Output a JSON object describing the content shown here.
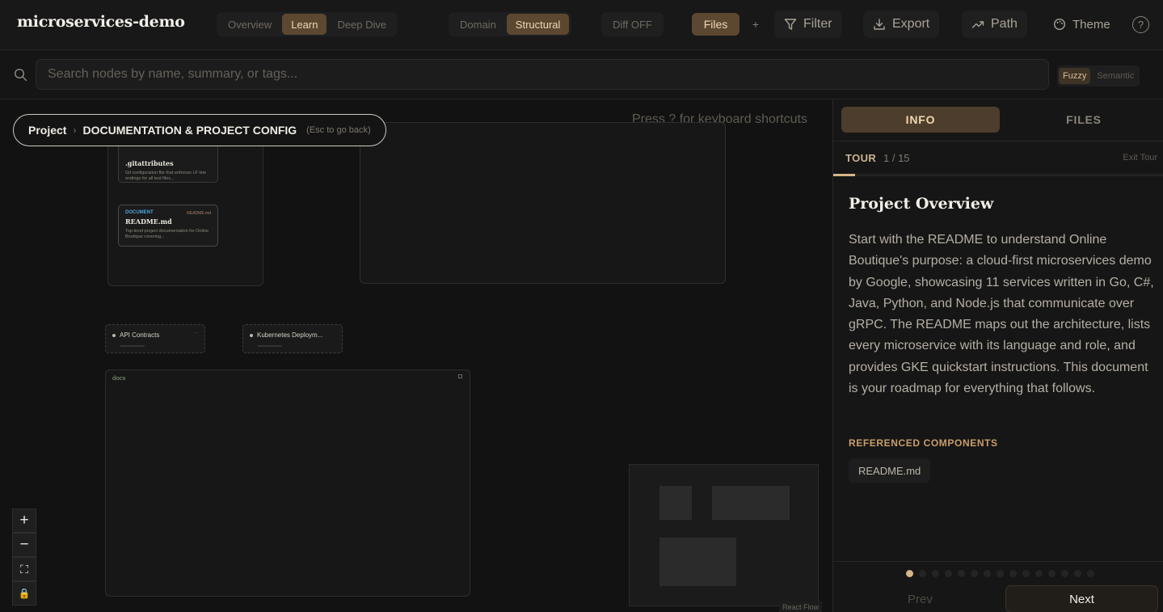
{
  "app": {
    "title": "microservices-demo"
  },
  "toolbar": {
    "view_modes": [
      "Overview",
      "Learn",
      "Deep Dive"
    ],
    "view_mode_active": "Learn",
    "lens_modes": [
      "Domain",
      "Structural"
    ],
    "lens_active": "Structural",
    "diff_label": "Diff OFF",
    "files_label": "Files",
    "plus_label": "+",
    "filter_label": "Filter",
    "export_label": "Export",
    "path_label": "Path",
    "theme_label": "Theme",
    "help_label": "?"
  },
  "search": {
    "placeholder": "Search nodes by name, summary, or tags...",
    "value": "",
    "modes": [
      "Fuzzy",
      "Semantic"
    ],
    "mode_active": "Fuzzy"
  },
  "canvas": {
    "breadcrumb": {
      "root": "Project",
      "current": "DOCUMENTATION & PROJECT CONFIG",
      "hint": "(Esc to go back)"
    },
    "keyboard_hint": "Press ? for keyboard shortcuts",
    "nodes": {
      "gitattributes": {
        "title": ".gitattributes",
        "desc": "Git configuration file that enforces LF line endings for all text files..."
      },
      "readme": {
        "kind": "DOCUMENT",
        "tag": "README.md",
        "title": "README.md",
        "desc": "Top-level project documentation for Online Boutique covering..."
      },
      "api_contracts": {
        "label": "API Contracts"
      },
      "k8s_deploy": {
        "label": "Kubernetes Deploym..."
      },
      "docs_group": {
        "label": "docs"
      }
    },
    "react_flow_label": "React Flow",
    "zoom_controls": [
      "+",
      "−",
      "⛶",
      "🔒"
    ]
  },
  "panel": {
    "tabs": [
      "INFO",
      "FILES"
    ],
    "tab_active": "INFO",
    "tour": {
      "label": "TOUR",
      "current": 1,
      "total": 15,
      "counter": "1 / 15",
      "exit_label": "Exit Tour",
      "progress": 0.0667
    },
    "step": {
      "title": "Project Overview",
      "body": "Start with the README to understand Online Boutique's purpose: a cloud-first microservices demo by Google, showcasing 11 services written in Go, C#, Java, Python, and Node.js that communicate over gRPC. The README maps out the architecture, lists every microservice with its language and role, and provides GKE quickstart instructions. This document is your roadmap for everything that follows."
    },
    "referenced_heading": "REFERENCED COMPONENTS",
    "referenced": [
      "README.md"
    ],
    "footer": {
      "prev_label": "Prev",
      "next_label": "Next"
    }
  },
  "colors": {
    "accent": "#5c4731",
    "accent_text": "#f0d8b5",
    "progress": "#d7b58b",
    "doc_kind": "#4aa3d8"
  }
}
